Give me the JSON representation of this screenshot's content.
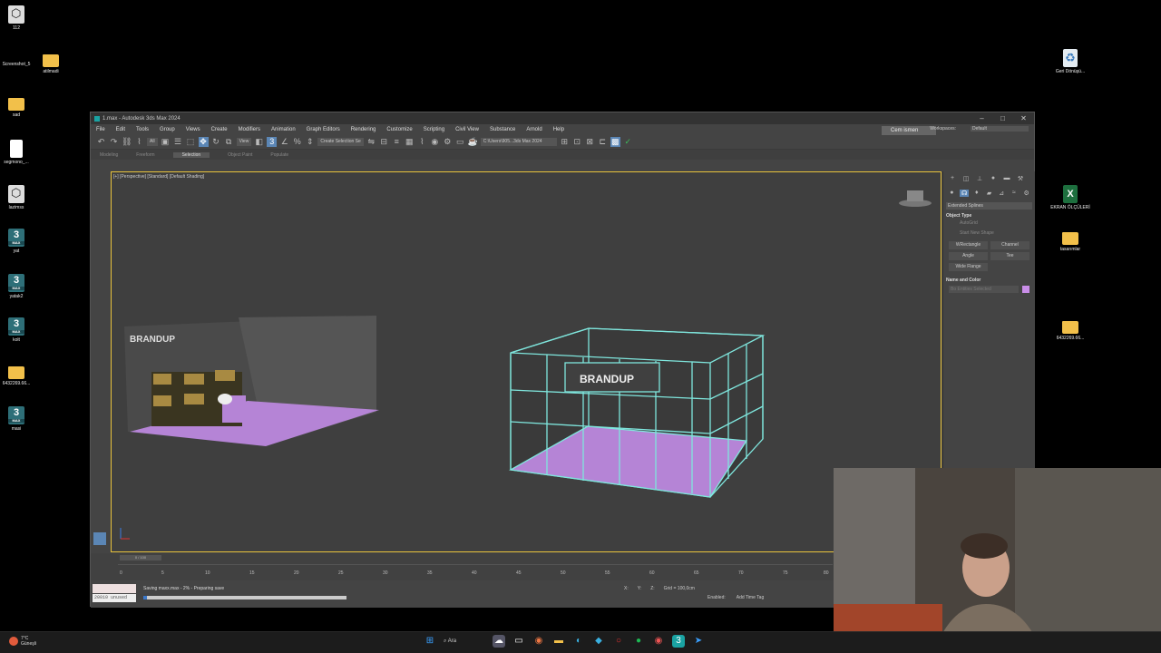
{
  "desktop": {
    "left_icons": [
      {
        "label": "112",
        "type": "cube"
      },
      {
        "label": "Screenshot_5",
        "type": "folder"
      },
      {
        "label": "atilmadi",
        "type": "folder"
      },
      {
        "label": "sad",
        "type": "folder"
      },
      {
        "label": "segmono_...",
        "type": "file"
      },
      {
        "label": "lazimss",
        "type": "cube"
      },
      {
        "label": "yat",
        "type": "max"
      },
      {
        "label": "yatak2",
        "type": "max"
      },
      {
        "label": "kolt",
        "type": "max"
      },
      {
        "label": "6432269.66...",
        "type": "folder"
      },
      {
        "label": "masi",
        "type": "max"
      }
    ],
    "right_icons": [
      {
        "label": "Geri Dönüşü...",
        "type": "recycle"
      },
      {
        "label": "EKRAN ÖLÇÜLERİ",
        "type": "excel"
      },
      {
        "label": "tasarımlar",
        "type": "folder"
      },
      {
        "label": "6432269.66...",
        "type": "folder"
      }
    ],
    "max_glyph": "3",
    "max_small": "MAX",
    "excel_glyph": "X",
    "recycle_glyph": "♻"
  },
  "app": {
    "title": "1.max - Autodesk 3ds Max 2024",
    "minimize": "–",
    "maximize": "□",
    "close": "✕",
    "menus": [
      "File",
      "Edit",
      "Tools",
      "Group",
      "Views",
      "Create",
      "Modifiers",
      "Animation",
      "Graph Editors",
      "Rendering",
      "Customize",
      "Scripting",
      "Civil View",
      "Substance",
      "Arnold",
      "Help"
    ],
    "user": "Cem ismen",
    "workspaces_label": "Workspaces:",
    "workspace_value": "Default",
    "toolbar": {
      "all_filter": "All",
      "view_dropdown": "View",
      "selection_set": "Create Selection Se",
      "path": "C:\\Users\\905...3ds Max 2024"
    },
    "ribbon_tabs": [
      "Modeling",
      "Freeform",
      "Selection",
      "Object Paint",
      "Populate"
    ],
    "ribbon_active": "Selection",
    "viewport_label": "[+] [Perspective] [Standard] [Default Shading]",
    "booth_text_left": "BRANDUP",
    "booth_text_right": "BRANDUP",
    "command_panel": {
      "category": "Extended Splines",
      "rollout_object_type": "Object Type",
      "autogrid": "AutoGrid",
      "start_new_shape": "Start New Shape",
      "buttons": [
        "WRectangle",
        "Channel",
        "Angle",
        "Tee",
        "Wide Flange"
      ],
      "rollout_name_color": "Name and Color",
      "name_value": "Bo Entities Selected",
      "color": "#c98ee8"
    },
    "timeline": {
      "slider": "0 / 100",
      "ticks": [
        "0",
        "5",
        "10",
        "15",
        "20",
        "25",
        "30",
        "35",
        "40",
        "45",
        "50",
        "55",
        "60",
        "65",
        "70",
        "75",
        "80"
      ]
    },
    "status": {
      "maxscript_text": "20010 unused",
      "message": "Saving maxx.max  -  2%  -  Preparing save",
      "progress": 0.02,
      "x_label": "X:",
      "y_label": "Y:",
      "z_label": "Z:",
      "grid": "Grid = 100,0cm",
      "enabled": "Enabled:",
      "add_time_tag": "Add Time Tag"
    }
  },
  "taskbar": {
    "temperature": "7°C",
    "weather": "Güneşli",
    "search": "Ara"
  }
}
